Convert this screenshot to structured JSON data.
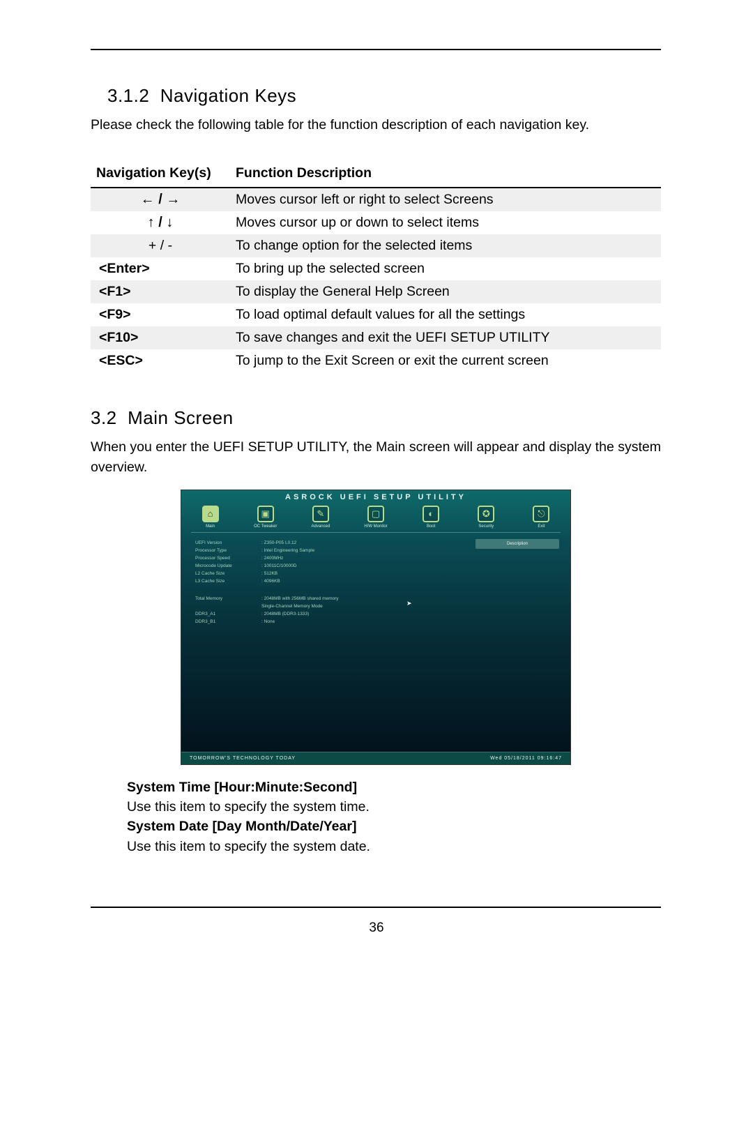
{
  "section_312": {
    "number": "3.1.2",
    "title": "Navigation Keys",
    "intro": "Please check the following table for the function description of each navigation key."
  },
  "nav_table": {
    "headers": {
      "keys": "Navigation Key(s)",
      "desc": "Function Description"
    },
    "rows": [
      {
        "key_glyph": "←  /  →",
        "desc": "Moves cursor left or right to select Screens",
        "bold": false
      },
      {
        "key_glyph": "↑  /  ↓",
        "desc": "Moves cursor up or down to select items",
        "bold": false
      },
      {
        "key_glyph": "+   /   -",
        "desc": "To change option for the selected items",
        "bold": false
      },
      {
        "key_glyph": "<Enter>",
        "desc": "To bring up the selected screen",
        "bold": true
      },
      {
        "key_glyph": "<F1>",
        "desc": "To display the General Help Screen",
        "bold": true
      },
      {
        "key_glyph": "<F9>",
        "desc": "To load optimal default values for all the settings",
        "bold": true
      },
      {
        "key_glyph": "<F10>",
        "desc": "To save changes and exit the UEFI SETUP UTILITY",
        "bold": true
      },
      {
        "key_glyph": "<ESC>",
        "desc": "To jump to the Exit Screen or exit the current screen",
        "bold": true
      }
    ]
  },
  "section_32": {
    "number": "3.2",
    "title": "Main Screen",
    "intro": "When you enter the UEFI SETUP UTILITY, the Main screen will appear and display the system overview."
  },
  "uefi": {
    "title": "ASROCK  UEFI  SETUP  UTILITY",
    "tabs": [
      {
        "label": "Main",
        "icon": "⌂",
        "active": true
      },
      {
        "label": "OC Tweaker",
        "icon": "▣",
        "active": false
      },
      {
        "label": "Advanced",
        "icon": "✎",
        "active": false
      },
      {
        "label": "H/W Monitor",
        "icon": "▢",
        "active": false
      },
      {
        "label": "Boot",
        "icon": "◐",
        "active": false
      },
      {
        "label": "Security",
        "icon": "✪",
        "active": false
      },
      {
        "label": "Exit",
        "icon": "⎋",
        "active": false
      }
    ],
    "info1": [
      {
        "k": "UEFI Version",
        "v": ": Z350-P05 L0.12"
      },
      {
        "k": "Processor Type",
        "v": ": Intel Engineering Sample"
      },
      {
        "k": "Processor Speed",
        "v": ": 2400MHz"
      },
      {
        "k": "Microcode Update",
        "v": ": 10011C/10000D"
      },
      {
        "k": "L2 Cache Size",
        "v": ": 512KB"
      },
      {
        "k": "L3 Cache Size",
        "v": ": 4096KB"
      }
    ],
    "info2": [
      {
        "k": "Total Memory",
        "v": ": 2048MB with 256MB shared memory"
      },
      {
        "k": "",
        "v": "  Single-Channel Memory Mode"
      },
      {
        "k": "DDR3_A1",
        "v": ": 2048MB (DDR3-1333)"
      },
      {
        "k": "DDR3_B1",
        "v": ": None"
      }
    ],
    "desc_label": "Description",
    "footer_left": "TOMORROW'S  TECHNOLOGY  TODAY",
    "footer_right": "Wed 05/18/2011  09:16:47"
  },
  "sys": {
    "time_h": "System Time [Hour:Minute:Second]",
    "time_d": "Use this item to specify the system time.",
    "date_h": "System Date [Day Month/Date/Year]",
    "date_d": "Use this item to specify the system date."
  },
  "page_number": "36"
}
